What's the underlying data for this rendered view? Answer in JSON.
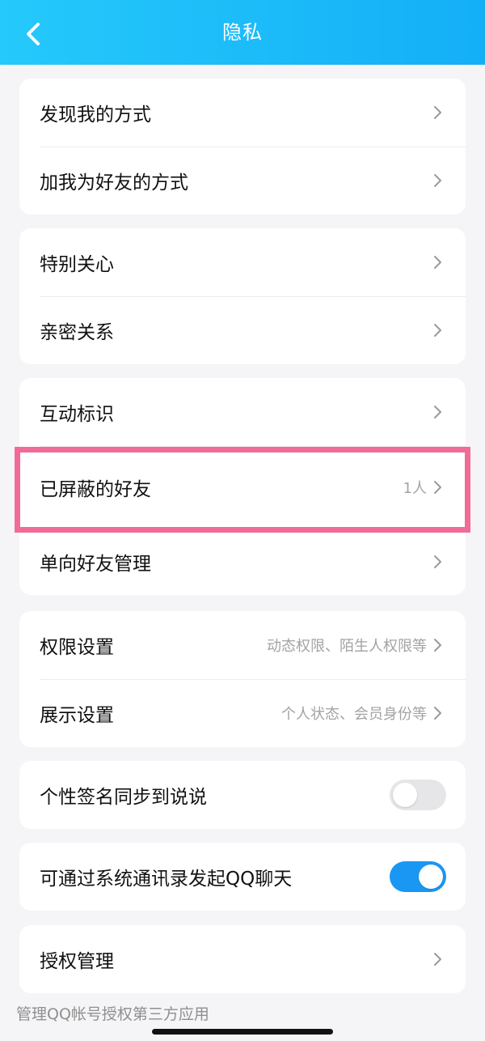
{
  "header": {
    "title": "隐私",
    "back_icon": "chevron-left-icon"
  },
  "colors": {
    "header_gradient_start": "#25c9fb",
    "header_gradient_end": "#14aff7",
    "toggle_on": "#1a97f3",
    "toggle_off": "#e6e6e9",
    "highlight": "#f16b97"
  },
  "groups": {
    "discover": {
      "items": [
        {
          "label": "发现我的方式"
        },
        {
          "label": "加我为好友的方式"
        }
      ]
    },
    "relations": {
      "items": [
        {
          "label": "特别关心"
        },
        {
          "label": "亲密关系"
        }
      ]
    },
    "friends": {
      "items": [
        {
          "label": "互动标识"
        },
        {
          "label": "已屏蔽的好友",
          "value": "1人"
        },
        {
          "label": "单向好友管理"
        }
      ]
    },
    "settings": {
      "items": [
        {
          "label": "权限设置",
          "value": "动态权限、陌生人权限等"
        },
        {
          "label": "展示设置",
          "value": "个人状态、会员身份等"
        }
      ]
    },
    "signature_sync": {
      "label": "个性签名同步到说说",
      "enabled": false
    },
    "contacts_chat": {
      "label": "可通过系统通讯录发起QQ聊天",
      "enabled": true
    },
    "auth": {
      "label": "授权管理",
      "note": "管理QQ帐号授权第三方应用"
    }
  }
}
